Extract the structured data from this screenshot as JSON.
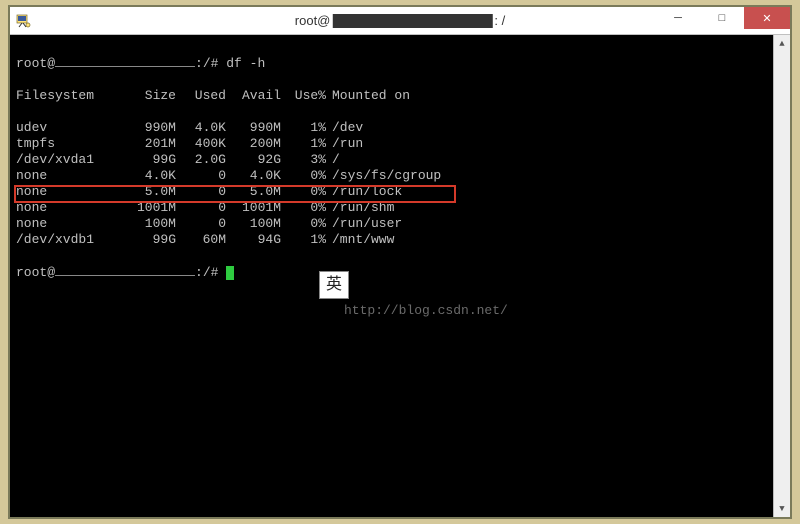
{
  "titlebar": {
    "prefix": "root@",
    "suffix": ": /"
  },
  "window_controls": {
    "min": "─",
    "max": "□",
    "close": "✕"
  },
  "terminal": {
    "prompt_user": "root@",
    "prompt_path": ":/#",
    "command": "df -h",
    "header": {
      "fs": "Filesystem",
      "size": "Size",
      "used": "Used",
      "avail": "Avail",
      "use": "Use%",
      "mnt": "Mounted on"
    },
    "rows": [
      {
        "fs": "udev",
        "size": "990M",
        "used": "4.0K",
        "avail": "990M",
        "use": "1%",
        "mnt": "/dev"
      },
      {
        "fs": "tmpfs",
        "size": "201M",
        "used": "400K",
        "avail": "200M",
        "use": "1%",
        "mnt": "/run"
      },
      {
        "fs": "/dev/xvda1",
        "size": "99G",
        "used": "2.0G",
        "avail": "92G",
        "use": "3%",
        "mnt": "/"
      },
      {
        "fs": "none",
        "size": "4.0K",
        "used": "0",
        "avail": "4.0K",
        "use": "0%",
        "mnt": "/sys/fs/cgroup"
      },
      {
        "fs": "none",
        "size": "5.0M",
        "used": "0",
        "avail": "5.0M",
        "use": "0%",
        "mnt": "/run/lock"
      },
      {
        "fs": "none",
        "size": "1001M",
        "used": "0",
        "avail": "1001M",
        "use": "0%",
        "mnt": "/run/shm"
      },
      {
        "fs": "none",
        "size": "100M",
        "used": "0",
        "avail": "100M",
        "use": "0%",
        "mnt": "/run/user"
      },
      {
        "fs": "/dev/xvdb1",
        "size": "99G",
        "used": "60M",
        "avail": "94G",
        "use": "1%",
        "mnt": "/mnt/www"
      }
    ]
  },
  "ime": {
    "label": "英"
  },
  "watermark": {
    "text": "http://blog.csdn.net/"
  },
  "scrollbar": {
    "up": "▲",
    "down": "▼"
  }
}
